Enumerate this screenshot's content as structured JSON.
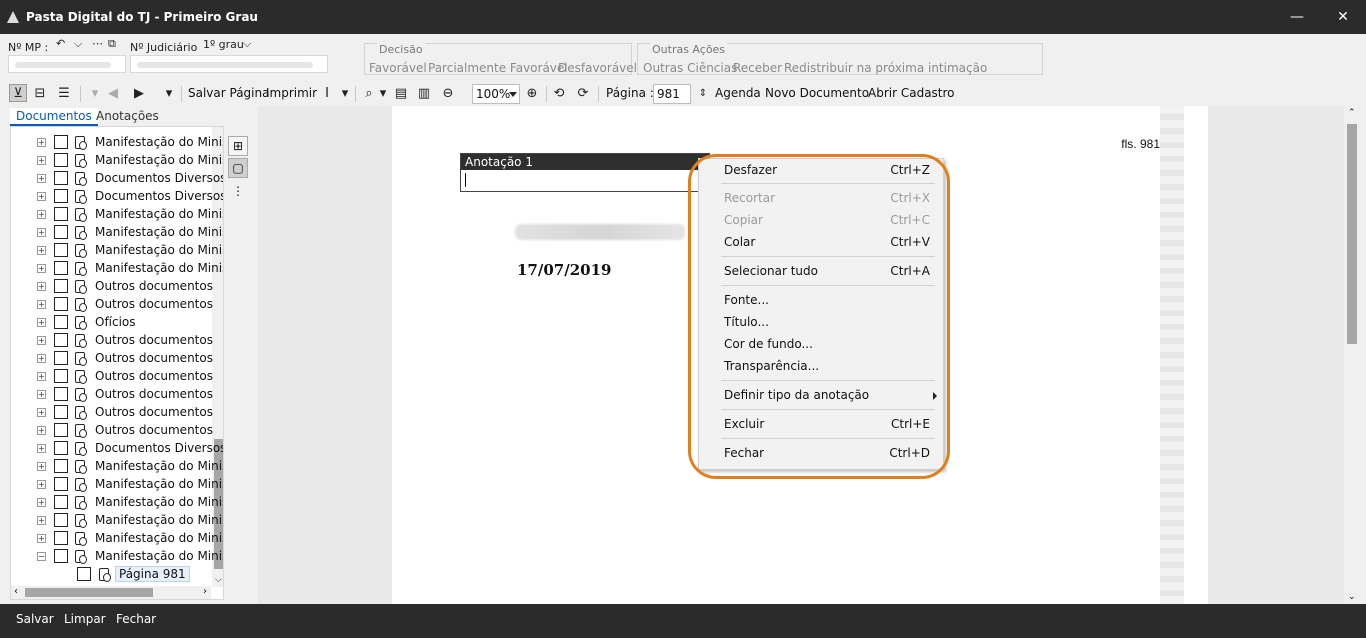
{
  "window": {
    "title": "Pasta Digital do TJ - Primeiro Grau",
    "minimize": "—",
    "close": "✕"
  },
  "fields": {
    "mp_label": "Nº MP :",
    "judicial_label": "Nº Judiciário",
    "grau_value": "1º grau"
  },
  "decisao": {
    "title": "Decisão",
    "items": [
      "Favorável",
      "Parcialmente Favorável",
      "Desfavorável"
    ]
  },
  "outras": {
    "title": "Outras Ações",
    "items": [
      "Outras Ciências",
      "Receber",
      "Redistribuir na próxima intimação"
    ]
  },
  "toolbar": {
    "save_page": "Salvar Página",
    "print": "Imprimir",
    "zoom": "100%",
    "page_label": "Página :",
    "page_value": "981",
    "agenda": "Agenda",
    "new_doc": "Novo Documento",
    "open_cadastro": "Abrir Cadastro"
  },
  "tabs": {
    "documentos": "Documentos",
    "anotacoes": "Anotações"
  },
  "tree": {
    "items": [
      "Manifestação do Minis",
      "Manifestação do Minis",
      "Documentos Diversos",
      "Documentos Diversos",
      "Manifestação do Minis",
      "Manifestação do Minis",
      "Manifestação do Minis",
      "Manifestação do Minis",
      "Outros documentos",
      "Outros documentos",
      "Ofícios",
      "Outros documentos",
      "Outros documentos",
      "Outros documentos",
      "Outros documentos",
      "Outros documentos",
      "Outros documentos",
      "Documentos Diversos",
      "Manifestação do Minis",
      "Manifestação do Minis",
      "Manifestação do Minis",
      "Manifestação do Minis",
      "Manifestação do Minis",
      "Manifestação do Minis"
    ],
    "child": "Página 981"
  },
  "document": {
    "fls": "fls. 981",
    "date": "17/07/2019"
  },
  "annotation": {
    "title": "Anotação 1"
  },
  "context_menu": {
    "undo": {
      "label": "Desfazer",
      "shortcut": "Ctrl+Z"
    },
    "cut": {
      "label": "Recortar",
      "shortcut": "Ctrl+X"
    },
    "copy": {
      "label": "Copiar",
      "shortcut": "Ctrl+C"
    },
    "paste": {
      "label": "Colar",
      "shortcut": "Ctrl+V"
    },
    "select_all": {
      "label": "Selecionar tudo",
      "shortcut": "Ctrl+A"
    },
    "font": {
      "label": "Fonte..."
    },
    "title": {
      "label": "Título..."
    },
    "bgcolor": {
      "label": "Cor de fundo..."
    },
    "transparency": {
      "label": "Transparência..."
    },
    "define_type": {
      "label": "Definir tipo da anotação"
    },
    "delete": {
      "label": "Excluir",
      "shortcut": "Ctrl+E"
    },
    "close": {
      "label": "Fechar",
      "shortcut": "Ctrl+D"
    }
  },
  "bottom": {
    "save": "Salvar",
    "clear": "Limpar",
    "close": "Fechar"
  },
  "colors": {
    "titlebar": "#2b2b2b",
    "highlight_outline": "#e07f1c",
    "tab_active": "#0a58b8"
  }
}
